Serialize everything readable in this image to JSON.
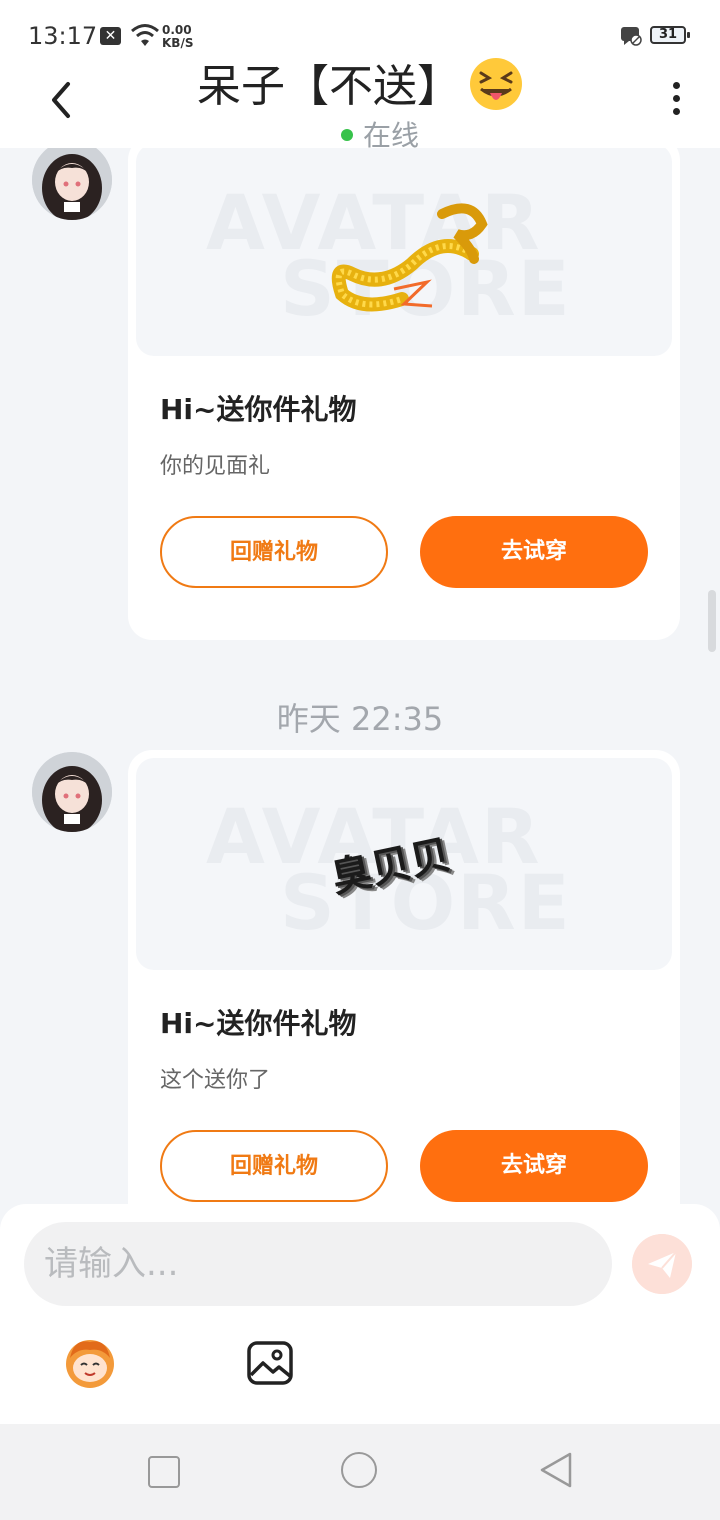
{
  "status_bar": {
    "time": "13:17",
    "net_speed_value": "0.00",
    "net_speed_unit": "KB/S",
    "battery": "31"
  },
  "header": {
    "title": "呆子【不送】",
    "status": "在线"
  },
  "messages": [
    {
      "heading": "Hi~送你件礼物",
      "text": "你的见面礼",
      "gift_caption": "",
      "return_label": "回赠礼物",
      "try_label": "去试穿"
    },
    {
      "heading": "Hi~送你件礼物",
      "text": "这个送你了",
      "gift_caption": "臭贝贝",
      "return_label": "回赠礼物",
      "try_label": "去试穿"
    }
  ],
  "watermark": {
    "line1": "AVATAR",
    "line2": "STORE"
  },
  "timestamp": "昨天 22:35",
  "composer": {
    "placeholder": "请输入..."
  },
  "colors": {
    "accent": "#ff6f0f",
    "online": "#37c24a",
    "background": "#f3f5f8"
  }
}
